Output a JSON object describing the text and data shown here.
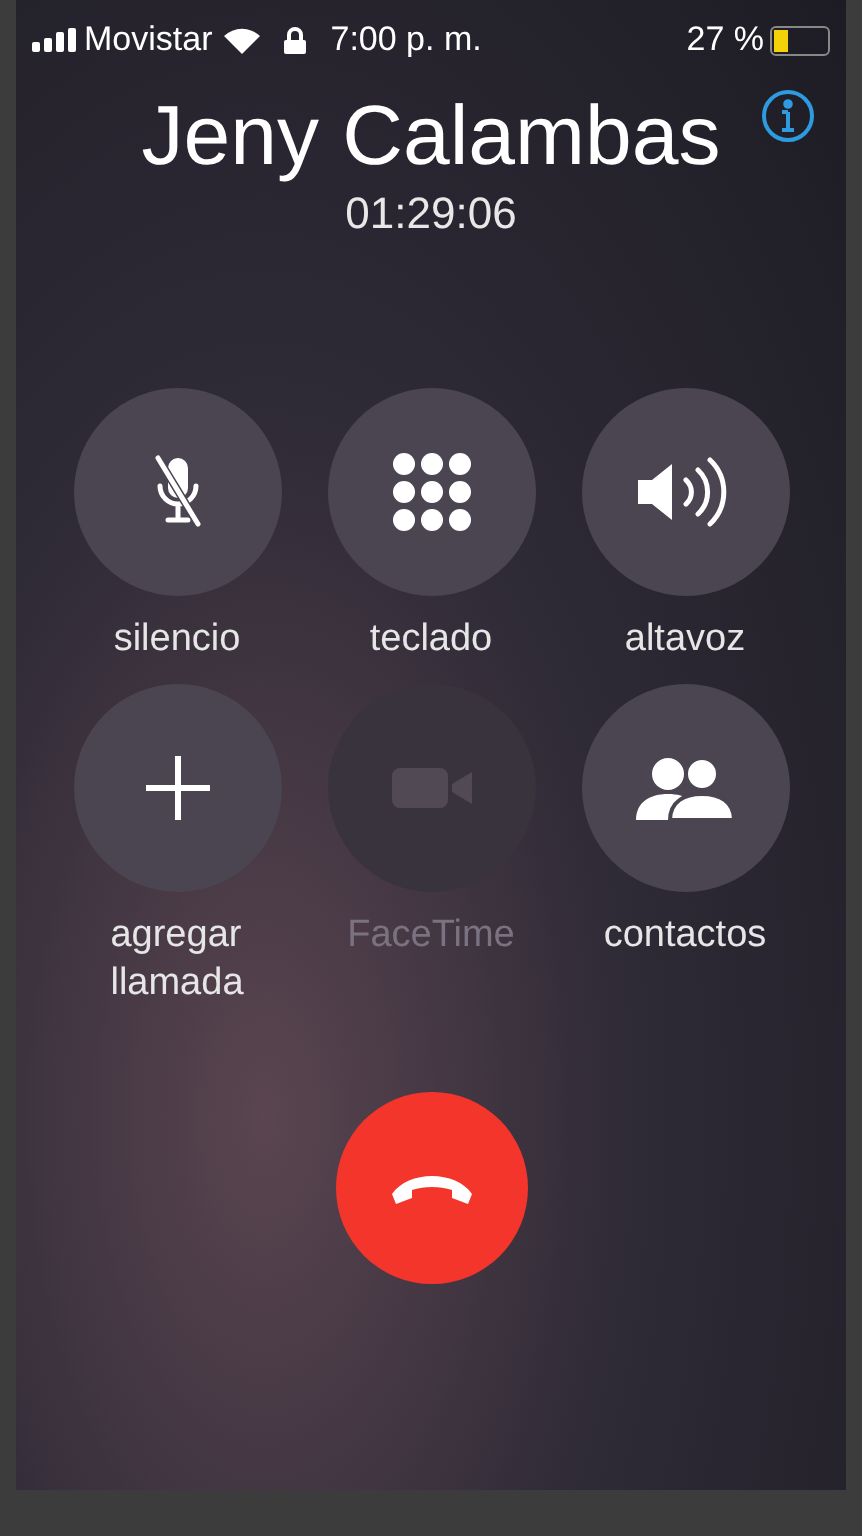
{
  "status_bar": {
    "carrier": "Movistar",
    "time": "7:00 p. m.",
    "battery_text": "27 %",
    "battery": {
      "level": 0.27
    }
  },
  "call": {
    "name": "Jeny Calambas",
    "duration": "01:29:06"
  },
  "buttons": [
    {
      "kind": "mute",
      "label": "silencio",
      "disabled": false
    },
    {
      "kind": "keypad",
      "label": "teclado",
      "disabled": false
    },
    {
      "kind": "speaker",
      "label": "altavoz",
      "disabled": false
    },
    {
      "kind": "add",
      "label": "agregar\nllamada",
      "disabled": false
    },
    {
      "kind": "facetime",
      "label": "FaceTime",
      "disabled": true
    },
    {
      "kind": "contacts",
      "label": "contactos",
      "disabled": false
    }
  ]
}
